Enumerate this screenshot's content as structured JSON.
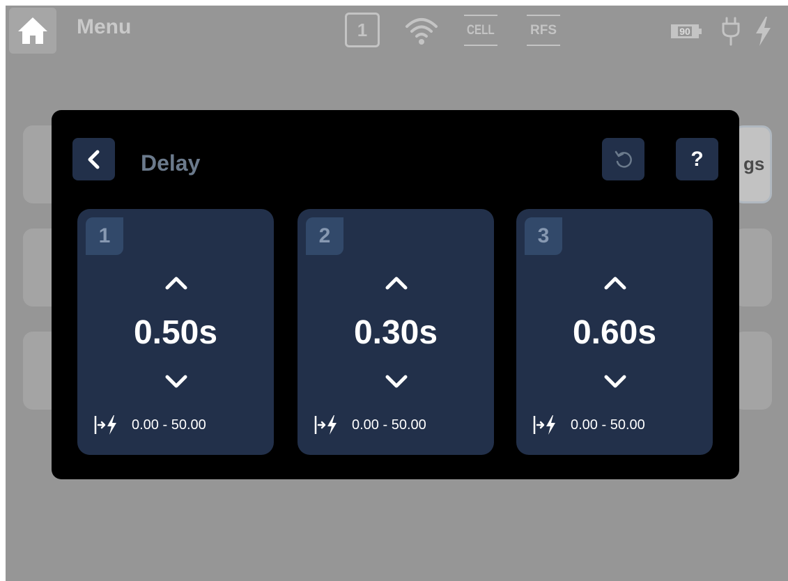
{
  "header": {
    "menu_label": "Menu",
    "profile_number": "1",
    "cell_label": "CELL",
    "rfs_label": "RFS",
    "battery_level": "90"
  },
  "background": {
    "partial_tile_text": "gs"
  },
  "dialog": {
    "title": "Delay",
    "help_label": "?",
    "channels": [
      {
        "index": "1",
        "value": "0.50s",
        "range": "0.00 - 50.00"
      },
      {
        "index": "2",
        "value": "0.30s",
        "range": "0.00 - 50.00"
      },
      {
        "index": "3",
        "value": "0.60s",
        "range": "0.00 - 50.00"
      }
    ]
  },
  "colors": {
    "overlay": "#969696",
    "modal": "#000000",
    "card": "#22304a",
    "badge": "#32496a",
    "title": "#6b7a8c"
  },
  "icons": [
    "home-icon",
    "wifi-icon",
    "plug-icon",
    "bolt-icon",
    "back-icon",
    "reset-icon",
    "chevron-up-icon",
    "chevron-down-icon",
    "delay-trigger-icon"
  ]
}
